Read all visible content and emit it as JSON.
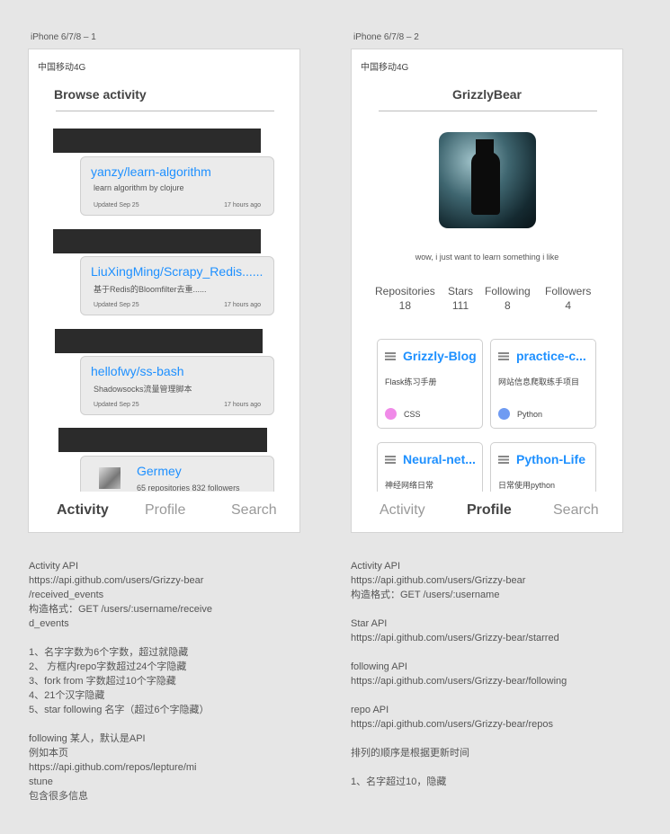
{
  "artboards": {
    "left_label": "iPhone 6/7/8 – 1",
    "right_label": "iPhone 6/7/8 – 2"
  },
  "status_bar": {
    "carrier": "中国移动4G"
  },
  "activity_screen": {
    "title": "Browse activity",
    "repos": [
      {
        "name": "yanzy/learn-algorithm",
        "description": "learn algorithm by clojure",
        "updated": "Updated Sep 25",
        "ago": "17 hours ago"
      },
      {
        "name": "LiuXingMing/Scrapy_Redis......",
        "description": "基于Redis的Bloomfilter去重......",
        "updated": "Updated Sep 25",
        "ago": "17 hours ago"
      },
      {
        "name": "hellofwy/ss-bash",
        "description": "Shadowsocks流量管理脚本",
        "updated": "Updated Sep 25",
        "ago": "17 hours ago"
      }
    ],
    "user": {
      "name": "Germey",
      "meta": "65 repositories 832 followers"
    }
  },
  "profile_screen": {
    "title": "GrizzlyBear",
    "bio": "wow, i just want to learn something i like",
    "stats": [
      {
        "label": "Repositories",
        "value": "18"
      },
      {
        "label": "Stars",
        "value": "111"
      },
      {
        "label": "Following",
        "value": "8"
      },
      {
        "label": "Followers",
        "value": "4"
      }
    ],
    "repos": [
      {
        "name": "Grizzly-Blog",
        "description": "Flask练习手册",
        "language": "CSS",
        "lang_color": "#f08ae8"
      },
      {
        "name": "practice-c...",
        "description": "网站信息爬取练手项目",
        "language": "Python",
        "lang_color": "#6f9bf2"
      },
      {
        "name": "Neural-net...",
        "description": "神经网络日常",
        "language": "",
        "lang_color": ""
      },
      {
        "name": "Python-Life",
        "description": "日常使用python",
        "language": "",
        "lang_color": ""
      }
    ]
  },
  "tabs": {
    "activity": "Activity",
    "profile": "Profile",
    "search": "Search"
  },
  "notes": {
    "left": "Activity   API\nhttps://api.github.com/users/Grizzy-bear\n/received_events\n构造格式：GET /users/:username/receive\nd_events\n\n1、名字字数为6个字数，超过就隐藏\n2、 方框内repo字数超过24个字隐藏\n3、fork from 字数超过10个字隐藏\n4、21个汉字隐藏\n5、star following 名字（超过6个字隐藏）\n\nfollowing 某人，默认是API\n例如本页\nhttps://api.github.com/repos/lepture/mi\nstune\n包含很多信息",
    "right": "Activity   API\nhttps://api.github.com/users/Grizzy-bear\n构造格式：GET /users/:username\n\nStar API\nhttps://api.github.com/users/Grizzy-bear/starred\n\nfollowing API\nhttps://api.github.com/users/Grizzy-bear/following\n\nrepo API\nhttps://api.github.com/users/Grizzy-bear/repos\n\n排列的顺序是根据更新时间\n\n1、名字超过10，隐藏"
  }
}
